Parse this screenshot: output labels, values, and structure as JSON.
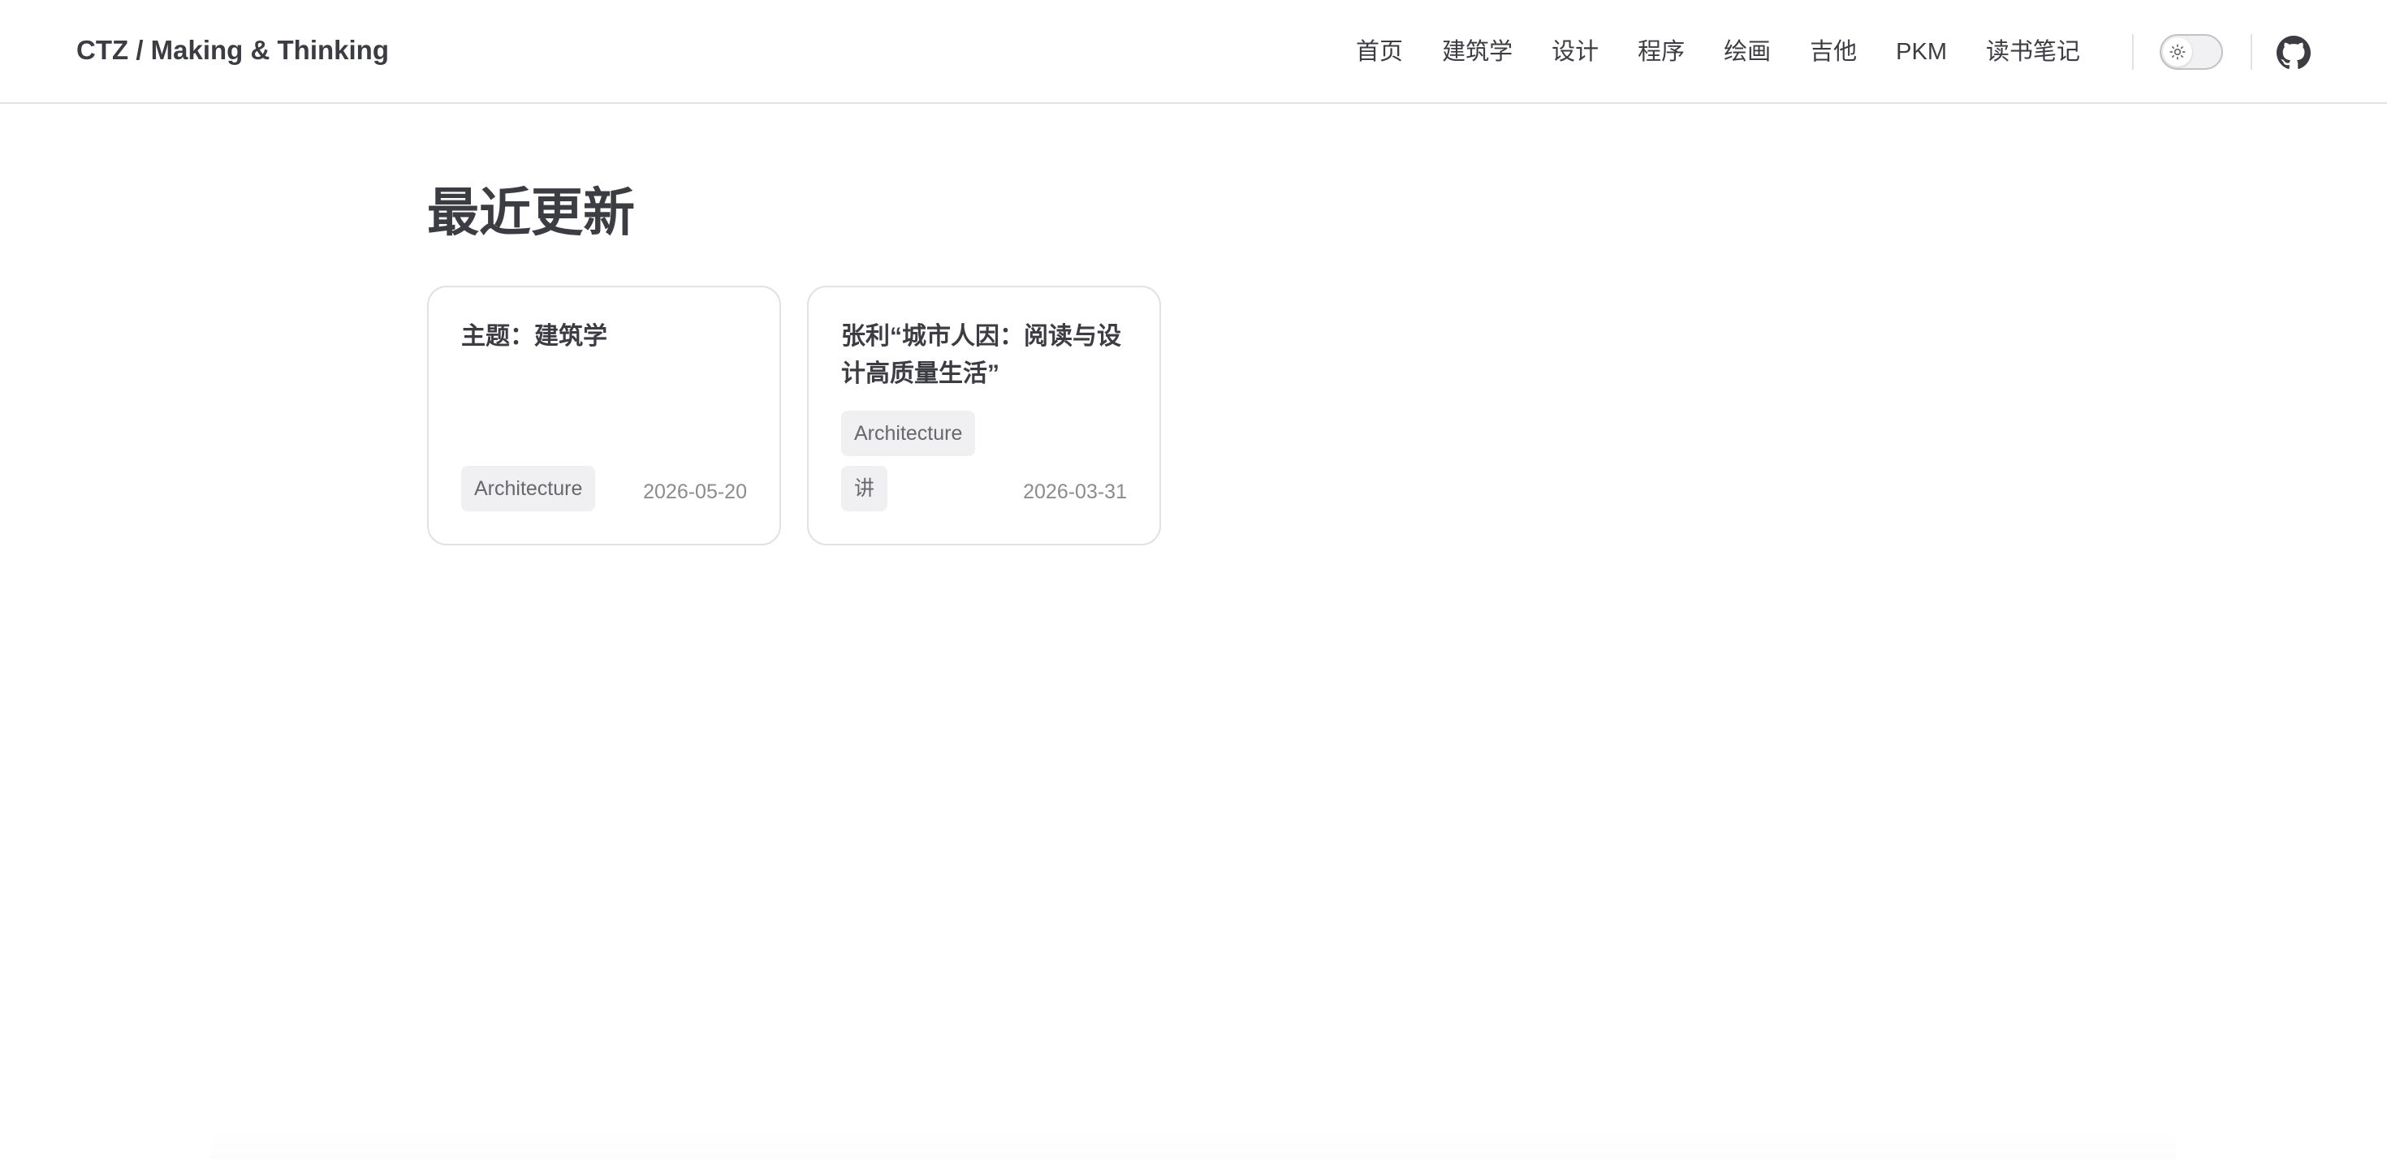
{
  "header": {
    "site_title": "CTZ / Making & Thinking",
    "nav": [
      {
        "label": "首页"
      },
      {
        "label": "建筑学"
      },
      {
        "label": "设计"
      },
      {
        "label": "程序"
      },
      {
        "label": "绘画"
      },
      {
        "label": "吉他"
      },
      {
        "label": "PKM"
      },
      {
        "label": "读书笔记"
      }
    ],
    "theme_icon": "sun-icon",
    "github_icon": "github-icon"
  },
  "main": {
    "title": "最近更新",
    "cards": [
      {
        "title": "主题：建筑学",
        "tags": [
          "Architecture"
        ],
        "date": "2026-05-20"
      },
      {
        "title": "张利“城市人因：阅读与设计高质量生活”",
        "tags": [
          "Architecture",
          "讲"
        ],
        "date": "2026-03-31"
      }
    ]
  },
  "colors": {
    "text": "#3c3c43",
    "muted": "#8b8b90",
    "border": "#e2e2e3",
    "tag_bg": "#f0f0f2"
  }
}
